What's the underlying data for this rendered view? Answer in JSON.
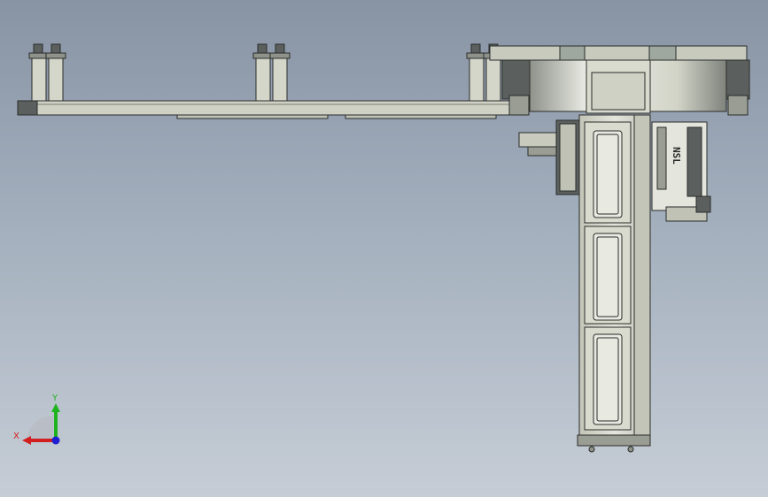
{
  "viewport": {
    "background_top": "#8894a4",
    "background_bottom": "#c6cdd6"
  },
  "model": {
    "part_color": "#d4d6c9",
    "edge_color": "#2a2c2a",
    "dark_part_color": "#5b5f5e",
    "vendor_mark": "NSL"
  },
  "triad": {
    "x_label": "X",
    "y_label": "Y",
    "x_color": "#d11f1f",
    "y_color": "#1fb41f",
    "z_color": "#1f1fd1"
  }
}
